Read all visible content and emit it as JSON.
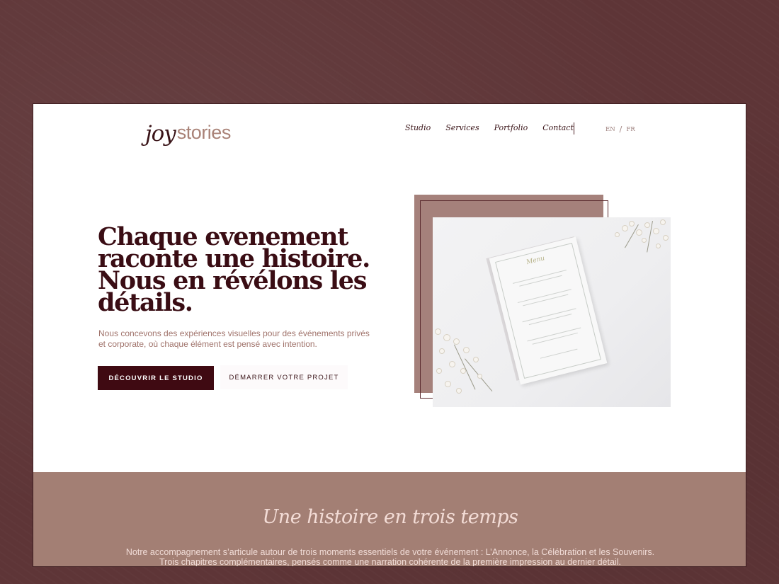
{
  "brand": {
    "logo_script": "joy",
    "logo_sans": "stories"
  },
  "nav": {
    "items": [
      {
        "label": "Studio"
      },
      {
        "label": "Services"
      },
      {
        "label": "Portfolio"
      },
      {
        "label": "Contact"
      }
    ],
    "lang": {
      "en": "EN",
      "separator": "/",
      "fr": "FR"
    }
  },
  "hero": {
    "title_lines": [
      "Chaque evenement",
      "raconte une histoire.",
      "Nous en révélons les",
      "détails."
    ],
    "subtitle_lines": [
      "Nous concevons des expériences visuelles pour des événements privés",
      "et corporate, où chaque élément est pensé avec intention."
    ],
    "primary_button": "DÉCOUVRIR LE STUDIO",
    "secondary_button": "DÉMARRER VOTRE PROJET",
    "image": {
      "card_title": "Menu",
      "icons": [
        "menu-card-image",
        "flower-icon"
      ]
    }
  },
  "section2": {
    "title": "Une histoire en trois temps",
    "text_lines": [
      "Notre accompagnement s’articule autour de trois moments essentiels de votre événement : L’Annonce, la Célébration et les Souvenirs.",
      "Trois chapitres complémentaires, pensés comme une narration cohérente de la première impression au dernier détail."
    ]
  },
  "colors": {
    "background": "#5e3537",
    "burgundy": "#3f0a12",
    "rose": "#a37f74",
    "text_muted": "#a0736b"
  }
}
